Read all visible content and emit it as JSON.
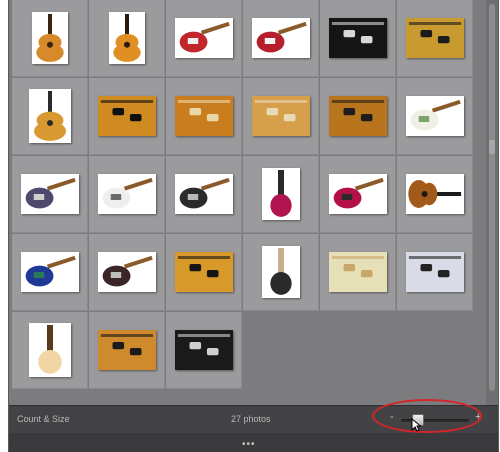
{
  "toolbar": {
    "left_label": "Count & Size",
    "center_label": "27 photos",
    "zoom_out_label": "-",
    "zoom_in_label": "+",
    "thumbnail_size_level": 0.2
  },
  "grip": {
    "dots": "•••"
  },
  "colors": {
    "grid_background": "#7c7c7e",
    "cell_background": "#9b9b9d",
    "toolbar_background": "#434345",
    "annotation_red": "#d8232a"
  },
  "photos": [
    {
      "kind": "acoustic",
      "body": "#d78a2a",
      "accent": "#3a2412"
    },
    {
      "kind": "acoustic",
      "body": "#e08f24",
      "accent": "#2b1a0c"
    },
    {
      "kind": "electric",
      "body": "#c0262a",
      "accent": "#f0f0f0"
    },
    {
      "kind": "electric",
      "body": "#b51f2c",
      "accent": "#f4f4f4"
    },
    {
      "kind": "closeup",
      "body": "#151515",
      "accent": "#d8d8d8"
    },
    {
      "kind": "closeup",
      "body": "#c99a2f",
      "accent": "#1b1b1b"
    },
    {
      "kind": "lespaul",
      "body": "#d89a30",
      "accent": "#2a2a2a"
    },
    {
      "kind": "closeup",
      "body": "#cf8b22",
      "accent": "#111111"
    },
    {
      "kind": "closeup",
      "body": "#c97d1f",
      "accent": "#e9d7a8"
    },
    {
      "kind": "closeup",
      "body": "#d6a04a",
      "accent": "#e9d9b6"
    },
    {
      "kind": "closeup",
      "body": "#b9751d",
      "accent": "#1d1d1d"
    },
    {
      "kind": "electric",
      "body": "#efefe5",
      "accent": "#7aa46b"
    },
    {
      "kind": "electric",
      "body": "#4d4a6e",
      "accent": "#cfcfcf"
    },
    {
      "kind": "electric",
      "body": "#eeeeee",
      "accent": "#6b6b6b"
    },
    {
      "kind": "electric",
      "body": "#2b2b2b",
      "accent": "#b8b8b8"
    },
    {
      "kind": "vertical",
      "body": "#b1154f",
      "accent": "#2a2a2a"
    },
    {
      "kind": "electric",
      "body": "#b3104a",
      "accent": "#2a2a2a"
    },
    {
      "kind": "acoustic-h",
      "body": "#a25a1a",
      "accent": "#1a1a1a"
    },
    {
      "kind": "electric",
      "body": "#1f3a96",
      "accent": "#2a7a5a"
    },
    {
      "kind": "electric",
      "body": "#3a2626",
      "accent": "#bfbfbf"
    },
    {
      "kind": "closeup",
      "body": "#d79a2a",
      "accent": "#151515"
    },
    {
      "kind": "vertical",
      "body": "#2a2a2a",
      "accent": "#c7b08a"
    },
    {
      "kind": "closeup",
      "body": "#e6e0b8",
      "accent": "#c9a56a"
    },
    {
      "kind": "closeup",
      "body": "#d9dbe6",
      "accent": "#222222"
    },
    {
      "kind": "neck",
      "body": "#f2d6a4",
      "accent": "#5a3a1a"
    },
    {
      "kind": "closeup",
      "body": "#d08a2e",
      "accent": "#1b1b1b"
    },
    {
      "kind": "closeup",
      "body": "#1a1a1a",
      "accent": "#d0d0d0"
    }
  ]
}
